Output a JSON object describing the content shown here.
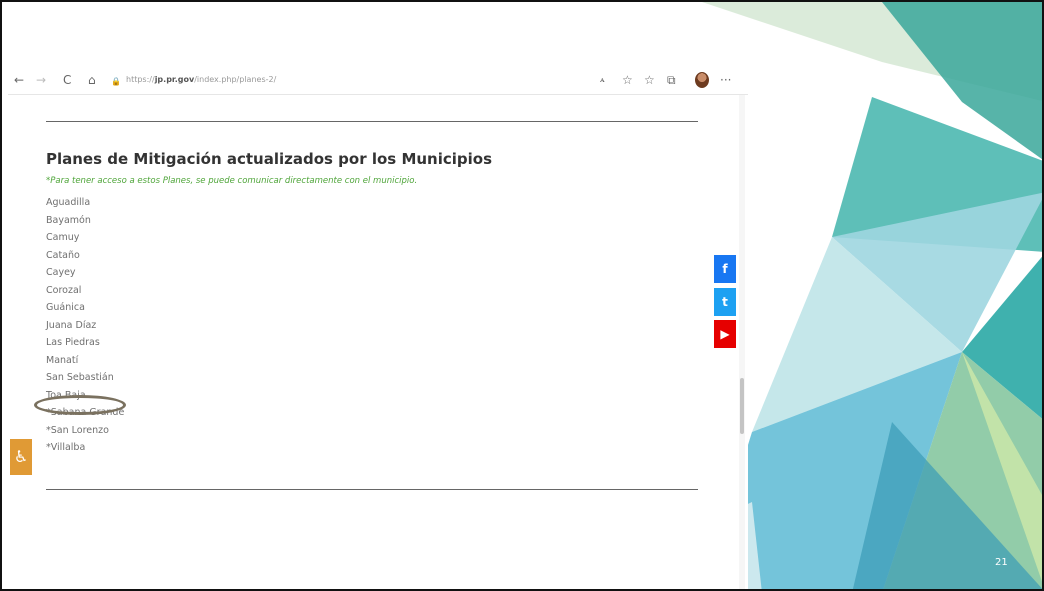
{
  "browser": {
    "url_prefix": "https://",
    "url_domain": "jp.pr.gov",
    "url_path": "/index.php/planes-2/",
    "nav_back": "←",
    "nav_forward": "→",
    "nav_reload": "C",
    "nav_home": "⌂",
    "lock": "🔒",
    "more": "···"
  },
  "page": {
    "title": "Planes de Mitigación actualizados por los  Municipios",
    "note": "*Para tener acceso a estos Planes, se puede comunicar directamente con el municipio.",
    "municipalities": [
      "Aguadilla",
      "Bayamón",
      "Camuy",
      "Cataño",
      "Cayey",
      "Corozal",
      "Guánica",
      "Juana Díaz",
      "Las Piedras",
      "Manatí",
      "San Sebastián",
      "Toa Baja",
      "*Sabana Grande",
      "*San Lorenzo",
      "*Villalba"
    ],
    "highlighted": "San Sebastián"
  },
  "social": {
    "facebook": "f",
    "twitter": "t",
    "youtube": "▶"
  },
  "accessibility": "♿",
  "slide": {
    "page_number": "21"
  }
}
